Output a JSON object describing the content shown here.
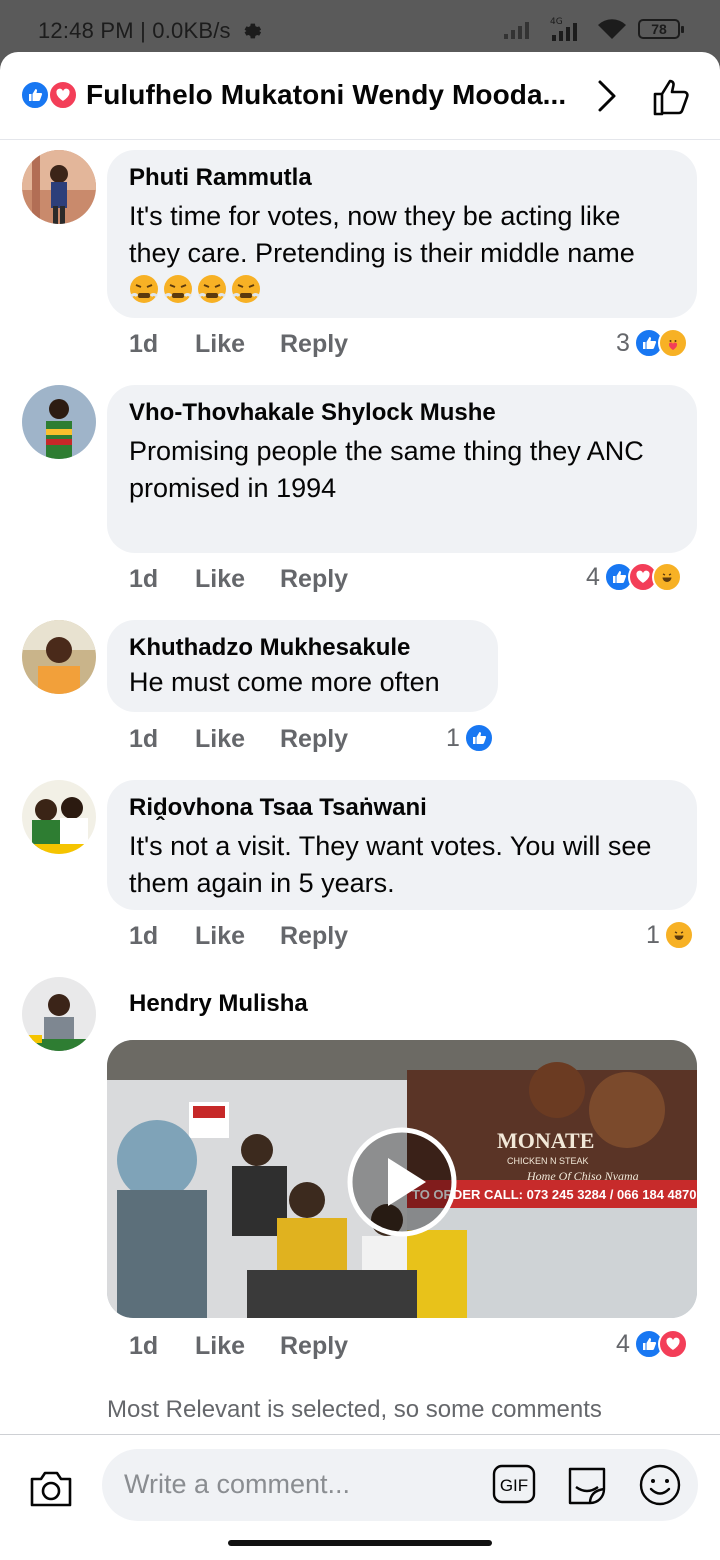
{
  "status": {
    "time": "12:48 PM | 0.0KB/s",
    "network": "4G",
    "battery": "78"
  },
  "header": {
    "title": "Fulufhelo Mukatoni Wendy Mooda...",
    "reactions": [
      "like-icon",
      "love-icon"
    ]
  },
  "comments": [
    {
      "author": "Phuti Rammutla",
      "text": "It's time for votes, now they be acting like they care. Pretending is their middle name",
      "emojis": [
        "😤",
        "😤",
        "😤",
        "😤"
      ],
      "time": "1d",
      "like": "Like",
      "reply": "Reply",
      "reaction_count": "3",
      "reactions": [
        "like",
        "care"
      ]
    },
    {
      "author": "Vho-Thovhakale Shylock Mushe",
      "text": "Promising people the same thing they ANC promised in 1994",
      "time": "1d",
      "like": "Like",
      "reply": "Reply",
      "reaction_count": "4",
      "reactions": [
        "like",
        "love",
        "haha"
      ]
    },
    {
      "author": "Khuthadzo Mukhesakule",
      "text": "He must come more often",
      "time": "1d",
      "like": "Like",
      "reply": "Reply",
      "reaction_count": "1",
      "reactions": [
        "like"
      ]
    },
    {
      "author": "Riḓovhona Tsaa Tsaṅwani",
      "text": "It's not a visit. They want votes. You will see them again in 5 years.",
      "time": "1d",
      "like": "Like",
      "reply": "Reply",
      "reaction_count": "1",
      "reactions": [
        "haha"
      ]
    },
    {
      "author": "Hendry Mulisha",
      "video": {
        "sign_brand": "MONATE",
        "sign_sub": "CHICKEN N STEAK",
        "sign_tag": "Home Of Chiso Nyama",
        "sign_order": "TO ORDER CALL: 073 245 3284 / 066 184 4870"
      },
      "time": "1d",
      "like": "Like",
      "reply": "Reply",
      "reaction_count": "4",
      "reactions": [
        "like",
        "love"
      ]
    }
  ],
  "footnote": "Most Relevant is selected, so some comments",
  "composer": {
    "placeholder": "Write a comment...",
    "gif_label": "GIF"
  },
  "colors": {
    "like": "#1877f2",
    "love": "#f33e58",
    "haha": "#f7b125",
    "text_muted": "#65676b",
    "bubble": "#f0f2f5"
  }
}
